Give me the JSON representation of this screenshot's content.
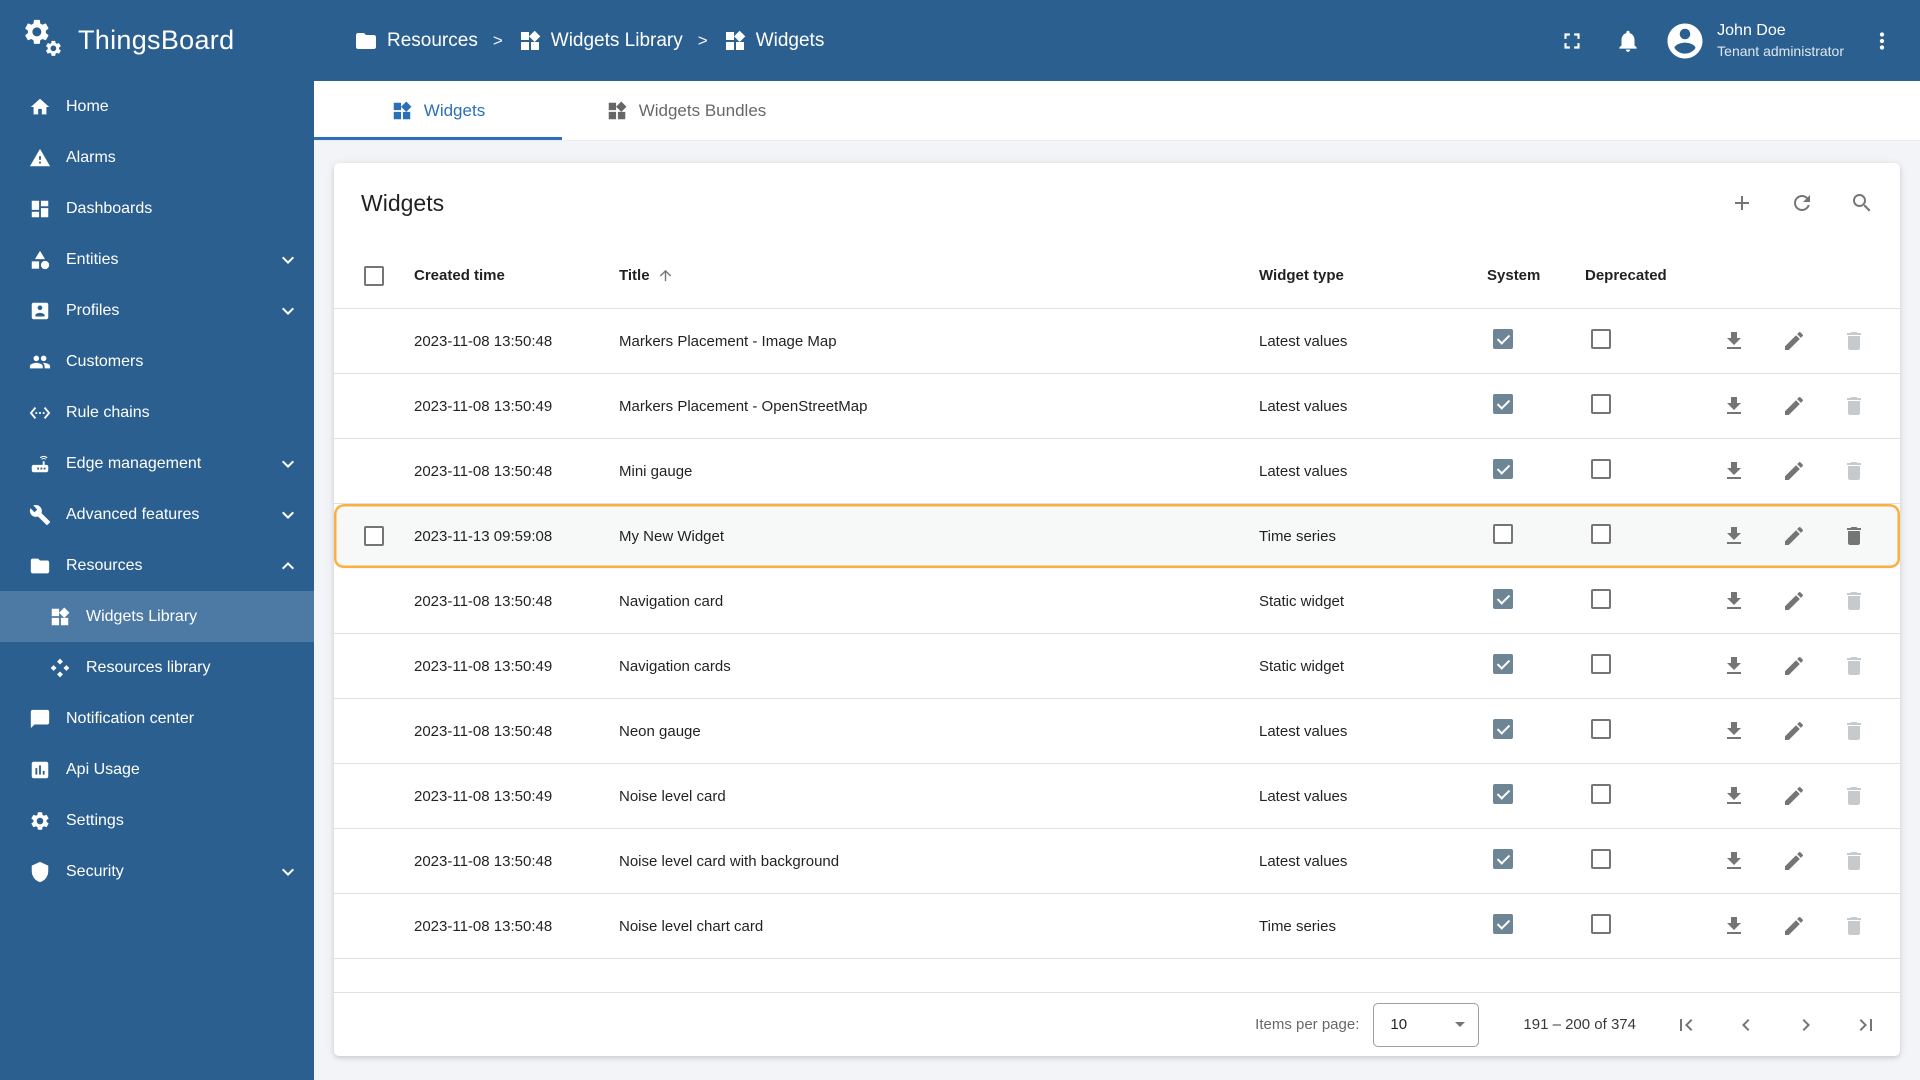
{
  "app": {
    "name": "ThingsBoard"
  },
  "user": {
    "name": "John Doe",
    "role": "Tenant administrator"
  },
  "breadcrumb": {
    "items": [
      {
        "label": "Resources",
        "icon": "folder"
      },
      {
        "label": "Widgets Library",
        "icon": "widgets"
      },
      {
        "label": "Widgets",
        "icon": "widgets"
      }
    ]
  },
  "sidebar": {
    "items": [
      {
        "label": "Home",
        "icon": "home"
      },
      {
        "label": "Alarms",
        "icon": "alarms"
      },
      {
        "label": "Dashboards",
        "icon": "dashboards"
      },
      {
        "label": "Entities",
        "icon": "entities",
        "expandable": true,
        "expanded": false
      },
      {
        "label": "Profiles",
        "icon": "profiles",
        "expandable": true,
        "expanded": false
      },
      {
        "label": "Customers",
        "icon": "customers"
      },
      {
        "label": "Rule chains",
        "icon": "rule-chains"
      },
      {
        "label": "Edge management",
        "icon": "edge-management",
        "expandable": true,
        "expanded": false
      },
      {
        "label": "Advanced features",
        "icon": "advanced-features",
        "expandable": true,
        "expanded": false
      },
      {
        "label": "Resources",
        "icon": "resources",
        "expandable": true,
        "expanded": true
      },
      {
        "label": "Widgets Library",
        "icon": "widgets",
        "child": true,
        "active": true
      },
      {
        "label": "Resources library",
        "icon": "resources-library",
        "child": true
      },
      {
        "label": "Notification center",
        "icon": "notification-center"
      },
      {
        "label": "Api Usage",
        "icon": "api-usage"
      },
      {
        "label": "Settings",
        "icon": "settings"
      },
      {
        "label": "Security",
        "icon": "security",
        "expandable": true,
        "expanded": false
      }
    ]
  },
  "tabs": [
    {
      "label": "Widgets",
      "icon": "widgets",
      "active": true
    },
    {
      "label": "Widgets Bundles",
      "icon": "widgets",
      "active": false
    }
  ],
  "table": {
    "title": "Widgets",
    "columns": {
      "created": "Created time",
      "title": "Title",
      "type": "Widget type",
      "system": "System",
      "deprecated": "Deprecated"
    },
    "sort": {
      "column": "Title",
      "direction": "ascending"
    },
    "rows": [
      {
        "created": "2023-11-08 13:50:48",
        "title": "Markers Placement - Image Map",
        "type": "Latest values",
        "system": true,
        "deprecated": false,
        "highlighted": false
      },
      {
        "created": "2023-11-08 13:50:49",
        "title": "Markers Placement - OpenStreetMap",
        "type": "Latest values",
        "system": true,
        "deprecated": false,
        "highlighted": false
      },
      {
        "created": "2023-11-08 13:50:48",
        "title": "Mini gauge",
        "type": "Latest values",
        "system": true,
        "deprecated": false,
        "highlighted": false
      },
      {
        "created": "2023-11-13 09:59:08",
        "title": "My New Widget",
        "type": "Time series",
        "system": false,
        "deprecated": false,
        "highlighted": true
      },
      {
        "created": "2023-11-08 13:50:48",
        "title": "Navigation card",
        "type": "Static widget",
        "system": true,
        "deprecated": false,
        "highlighted": false
      },
      {
        "created": "2023-11-08 13:50:49",
        "title": "Navigation cards",
        "type": "Static widget",
        "system": true,
        "deprecated": false,
        "highlighted": false
      },
      {
        "created": "2023-11-08 13:50:48",
        "title": "Neon gauge",
        "type": "Latest values",
        "system": true,
        "deprecated": false,
        "highlighted": false
      },
      {
        "created": "2023-11-08 13:50:49",
        "title": "Noise level card",
        "type": "Latest values",
        "system": true,
        "deprecated": false,
        "highlighted": false
      },
      {
        "created": "2023-11-08 13:50:48",
        "title": "Noise level card with background",
        "type": "Latest values",
        "system": true,
        "deprecated": false,
        "highlighted": false
      },
      {
        "created": "2023-11-08 13:50:48",
        "title": "Noise level chart card",
        "type": "Time series",
        "system": true,
        "deprecated": false,
        "highlighted": false
      }
    ]
  },
  "pagination": {
    "items_per_page_label": "Items per page:",
    "items_per_page": "10",
    "range": "191 – 200 of 374"
  },
  "colors": {
    "topbar_bg": "#2b5f8f",
    "sidebar_bg": "#2b5f8f",
    "sidebar_active": "#4d7aa5",
    "accent": "#2a6fb8",
    "highlight_border": "#fbaf3f",
    "checkbox_checked": "#6d8594"
  }
}
